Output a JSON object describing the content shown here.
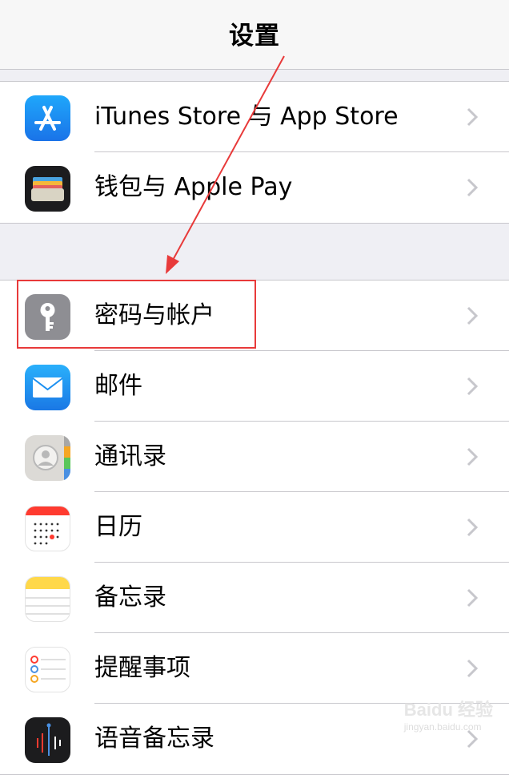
{
  "nav": {
    "title": "设置"
  },
  "group1": [
    {
      "label": "iTunes Store 与 App Store",
      "icon": "app-store-icon"
    },
    {
      "label": "钱包与 Apple Pay",
      "icon": "wallet-icon"
    }
  ],
  "group2": [
    {
      "label": "密码与帐户",
      "icon": "key-icon"
    },
    {
      "label": "邮件",
      "icon": "mail-icon"
    },
    {
      "label": "通讯录",
      "icon": "contacts-icon"
    },
    {
      "label": "日历",
      "icon": "calendar-icon"
    },
    {
      "label": "备忘录",
      "icon": "notes-icon"
    },
    {
      "label": "提醒事项",
      "icon": "reminders-icon"
    },
    {
      "label": "语音备忘录",
      "icon": "voice-memos-icon"
    }
  ],
  "watermark": {
    "brand": "Baidu 经验",
    "site": "jingyan.baidu.com"
  },
  "colors": {
    "highlight": "#e83a3a",
    "app_store": "#1d8cf8",
    "mail": "#1f8ef1",
    "calendar": "#ff3b30",
    "notes": "#ffd84a"
  }
}
